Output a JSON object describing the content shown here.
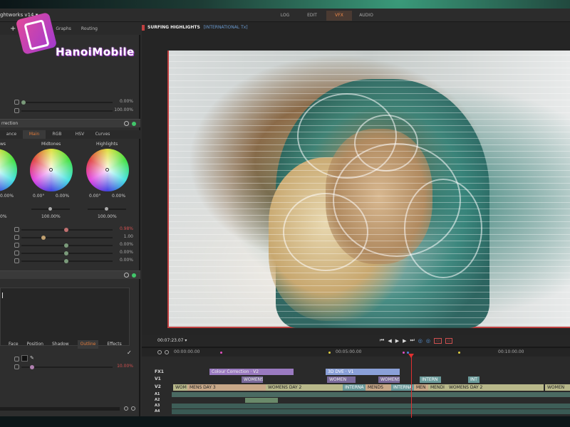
{
  "app": {
    "title": "ghtworks v14 ▾",
    "modes": [
      "LOG",
      "EDIT",
      "VFX",
      "AUDIO"
    ]
  },
  "watermark": {
    "text": "HanoiMobile"
  },
  "left_panel": {
    "tabs": [
      "Graphs",
      "Routing"
    ],
    "plus": "+",
    "top_sliders": [
      {
        "value": "0.00%"
      },
      {
        "value": "100.00%"
      }
    ],
    "section_title": "rrection",
    "sub_tabs": [
      "ance",
      "Main",
      "RGB",
      "HSV",
      "Curves"
    ],
    "wheels": [
      {
        "label": "ws",
        "a": "0.00%",
        "b": "",
        "percent": "0%"
      },
      {
        "label": "Midtones",
        "a": "0.00°",
        "b": "0.00%",
        "percent": "100.00%"
      },
      {
        "label": "Highlights",
        "a": "0.00°",
        "b": "0.00%",
        "percent": "100.00%"
      }
    ],
    "sliders": [
      {
        "value": "0.98%",
        "red": true
      },
      {
        "value": "1.00",
        "red": false
      },
      {
        "value": "0.00%",
        "red": false
      },
      {
        "value": "0.00%",
        "red": false
      },
      {
        "value": "0.00%",
        "red": false
      }
    ],
    "bottom_tabs": [
      "Face",
      "Position",
      "Shadow",
      "Outline",
      "Effects"
    ],
    "outline_value": "10.00%",
    "checkmark": "✓"
  },
  "viewer": {
    "title": "SURFING HIGHLIGHTS",
    "subtitle": "[INTERNATIONAL Tx]",
    "timecode": "00:07:23.07 ▾",
    "transport": [
      "⏮",
      "◀",
      "▶",
      "▶",
      "⏭",
      "◎",
      "◎",
      "▭",
      "▭"
    ]
  },
  "timeline": {
    "ruler": [
      "00:00:00.00",
      "00:05:00.00",
      "00:10:00.00"
    ],
    "tracks": [
      "FX1",
      "V1",
      "V2",
      "A1",
      "A2",
      "A3",
      "A4"
    ],
    "fx_clips": [
      "Colour Correction · V2",
      "3D DVE · V1"
    ],
    "v1_clips": [
      "WOMENS",
      "WOMEN",
      "WOMENS",
      "INTERN",
      "INT"
    ],
    "v2_clips": [
      "WOM",
      "MENS DAY 3",
      "WOMENS DAY 2",
      "INTERNA",
      "MENDS",
      "INTERNA",
      "MEN",
      "MENDI",
      "WOMENS DAY 2",
      "WOMEN"
    ]
  }
}
